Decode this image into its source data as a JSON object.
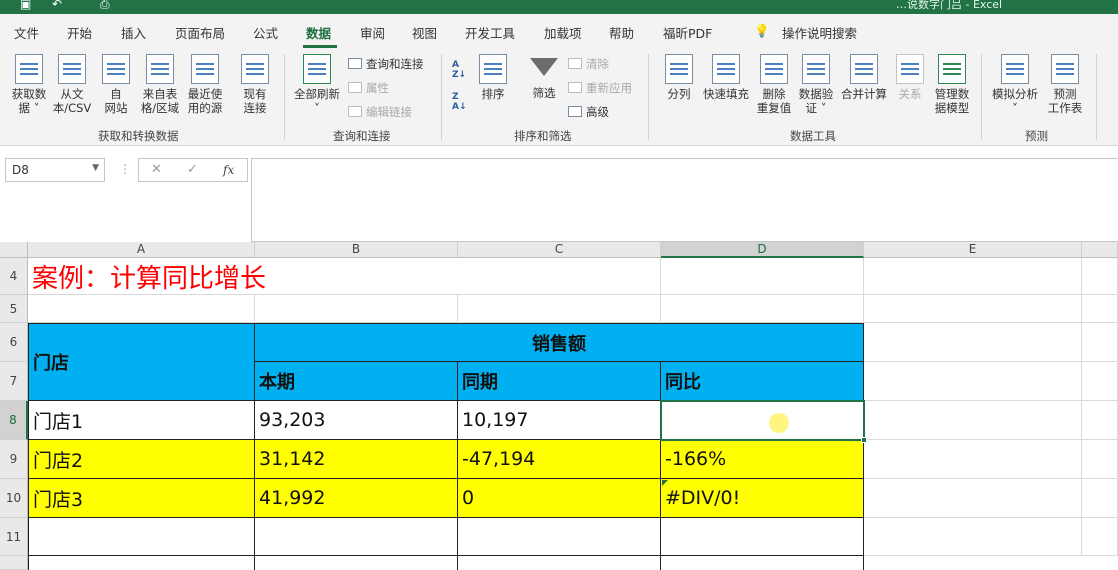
{
  "titlebar": {
    "doc_title": "…说数字门吕 - Excel"
  },
  "tabs": [
    {
      "label": "文件"
    },
    {
      "label": "开始"
    },
    {
      "label": "插入"
    },
    {
      "label": "页面布局"
    },
    {
      "label": "公式"
    },
    {
      "label": "数据",
      "active": true
    },
    {
      "label": "审阅"
    },
    {
      "label": "视图"
    },
    {
      "label": "开发工具"
    },
    {
      "label": "加载项"
    },
    {
      "label": "帮助"
    },
    {
      "label": "福昕PDF"
    }
  ],
  "search": {
    "label": "操作说明搜索",
    "icon": "lightbulb-icon"
  },
  "ribbon": {
    "get_transform": {
      "label": "获取和转换数据",
      "buttons": [
        {
          "line1": "获取数",
          "line2": "据 ˅"
        },
        {
          "line1": "从文",
          "line2": "本/CSV"
        },
        {
          "line1": "自",
          "line2": "网站"
        },
        {
          "line1": "来自表",
          "line2": "格/区域"
        },
        {
          "line1": "最近使",
          "line2": "用的源"
        },
        {
          "line1": "现有",
          "line2": "连接"
        }
      ]
    },
    "queries": {
      "label": "查询和连接",
      "refresh": {
        "line1": "全部刷新",
        "line2": "˅"
      },
      "items": [
        "查询和连接",
        "属性",
        "编辑链接"
      ]
    },
    "sort_filter": {
      "label": "排序和筛选",
      "sort": "排序",
      "filter": "筛选",
      "items": [
        "清除",
        "重新应用",
        "高级"
      ]
    },
    "data_tools": {
      "label": "数据工具",
      "buttons": [
        {
          "line1": "分列",
          "line2": ""
        },
        {
          "line1": "快速填充",
          "line2": ""
        },
        {
          "line1": "删除",
          "line2": "重复值"
        },
        {
          "line1": "数据验",
          "line2": "证 ˅"
        },
        {
          "line1": "合并计算",
          "line2": ""
        },
        {
          "line1": "关系",
          "line2": ""
        },
        {
          "line1": "管理数",
          "line2": "据模型"
        }
      ]
    },
    "forecast": {
      "label": "预测",
      "buttons": [
        {
          "line1": "模拟分析",
          "line2": "˅"
        },
        {
          "line1": "预测",
          "line2": "工作表"
        }
      ]
    }
  },
  "formula_bar": {
    "name_box": "D8",
    "formula": ""
  },
  "columns": [
    "A",
    "B",
    "C",
    "D",
    "E"
  ],
  "rows": [
    "4",
    "5",
    "6",
    "7",
    "8",
    "9",
    "10",
    "11"
  ],
  "sheet": {
    "title": "案例：计算同比增长",
    "header_store": "门店",
    "header_sales": "销售额",
    "header_current": "本期",
    "header_prior": "同期",
    "header_yoy": "同比",
    "data": [
      {
        "store": "门店1",
        "current": "93,203",
        "prior": "10,197",
        "yoy": ""
      },
      {
        "store": "门店2",
        "current": "31,142",
        "prior": "-47,194",
        "yoy": "-166%"
      },
      {
        "store": "门店3",
        "current": "41,992",
        "prior": "0",
        "yoy": "#DIV/0!"
      }
    ]
  },
  "colors": {
    "excel_green": "#217346",
    "header_blue": "#00b0f0",
    "highlight_yellow": "#ffff00",
    "title_red": "#ff0000"
  }
}
